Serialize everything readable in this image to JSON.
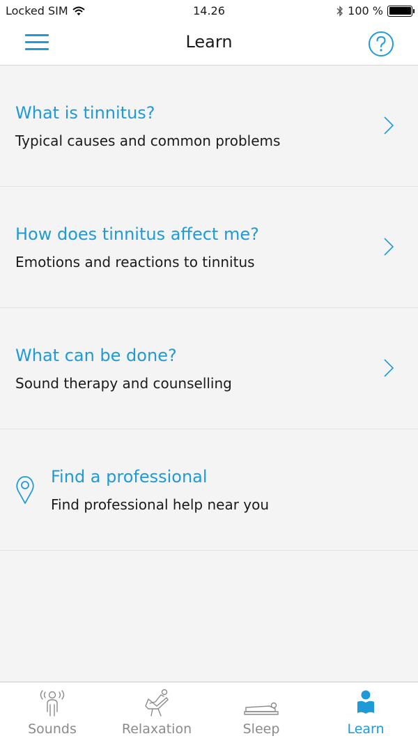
{
  "status": {
    "carrier": "Locked SIM",
    "time": "14.26",
    "battery": "100 %"
  },
  "nav": {
    "title": "Learn"
  },
  "items": [
    {
      "title": "What is tinnitus?",
      "subtitle": "Typical causes and common problems",
      "icon": "chevron-right-icon"
    },
    {
      "title": "How does tinnitus affect me?",
      "subtitle": "Emotions and reactions to tinnitus",
      "icon": "chevron-right-icon"
    },
    {
      "title": "What can be done?",
      "subtitle": "Sound therapy and counselling",
      "icon": "chevron-right-icon"
    },
    {
      "title": "Find a professional",
      "subtitle": "Find professional help near you",
      "icon": "location-pin-icon"
    }
  ],
  "tabs": [
    {
      "label": "Sounds",
      "icon": "sounds-person-icon",
      "active": false
    },
    {
      "label": "Relaxation",
      "icon": "relaxation-chair-icon",
      "active": false
    },
    {
      "label": "Sleep",
      "icon": "sleep-bed-icon",
      "active": false
    },
    {
      "label": "Learn",
      "icon": "learn-reader-icon",
      "active": true
    }
  ],
  "colors": {
    "accent": "#1f9ad6",
    "background": "#f4f4f4",
    "inactive_tab": "#8a8a8a"
  }
}
